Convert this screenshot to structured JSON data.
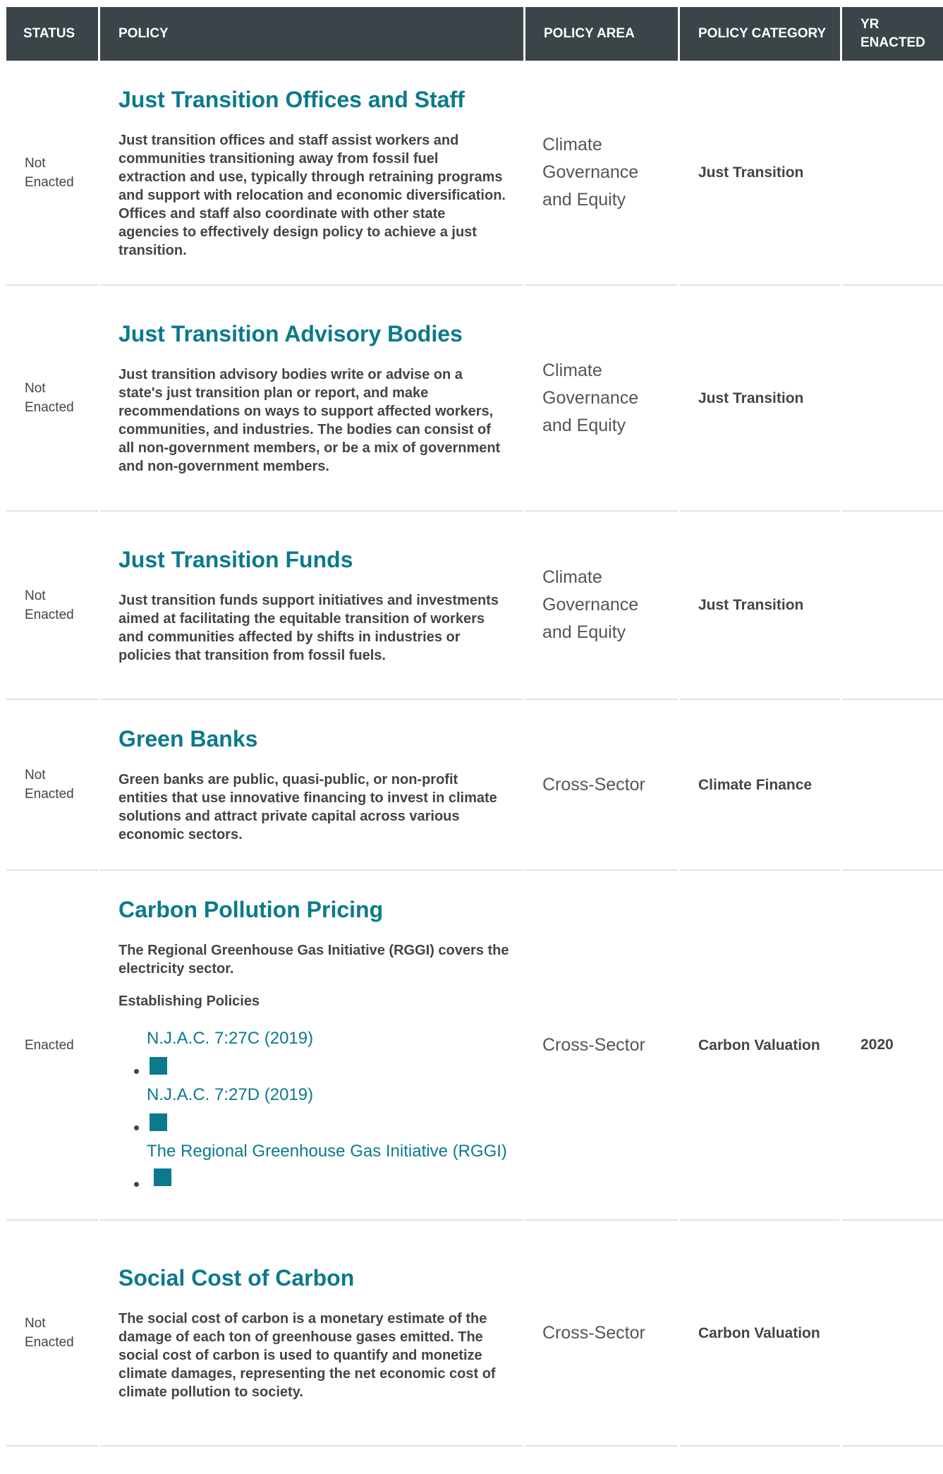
{
  "header": {
    "status": "STATUS",
    "policy": "POLICY",
    "policy_area": "POLICY AREA",
    "policy_category": "POLICY CATEGORY",
    "yr_enacted": "YR ENACTED"
  },
  "rows": [
    {
      "status": "Not Enacted",
      "title": "Just Transition Offices and Staff",
      "description": "Just transition offices and staff assist workers and communities transitioning away from fossil fuel extraction and use, typically through retraining programs and support with relocation and economic diversification. Offices and staff also coordinate with other state agencies to effectively design policy to achieve a just transition.",
      "area": "Climate Governance and Equity",
      "category": "Just Transition",
      "year": ""
    },
    {
      "status": "Not Enacted",
      "title": "Just Transition Advisory Bodies",
      "description": "Just transition advisory bodies write or advise on a state's just transition plan or report, and make recommendations on ways to support affected workers, communities, and industries. The bodies can consist of all non-government members, or be a mix of government and non-government members.",
      "area": "Climate Governance and Equity",
      "category": "Just Transition",
      "year": ""
    },
    {
      "status": "Not Enacted",
      "title": "Just Transition Funds",
      "description": "Just transition funds support initiatives and investments aimed at facilitating the equitable transition of workers and communities affected by shifts in industries or policies that transition from fossil fuels.",
      "area": "Climate Governance and Equity",
      "category": "Just Transition",
      "year": ""
    },
    {
      "status": "Not Enacted",
      "title": "Green Banks",
      "description": "Green banks are public, quasi-public, or non-profit entities that use innovative financing to invest in climate solutions and attract private capital across various economic sectors.",
      "area": "Cross-Sector",
      "category": "Climate Finance",
      "year": ""
    },
    {
      "status": "Enacted",
      "title": "Carbon Pollution Pricing",
      "description": "The Regional Greenhouse Gas Initiative (RGGI) covers the electricity sector.",
      "establishing_label": "Establishing Policies",
      "links": [
        "N.J.A.C. 7:27C (2019)",
        "N.J.A.C. 7:27D (2019)",
        "The Regional Greenhouse Gas Initiative (RGGI)"
      ],
      "area": "Cross-Sector",
      "category": "Carbon Valuation",
      "year": "2020"
    },
    {
      "status": "Not Enacted",
      "title": "Social Cost of Carbon",
      "description": "The social cost of carbon is a monetary estimate of the damage of each ton of greenhouse gases emitted. The social cost of carbon is used to quantify and monetize climate damages, representing the net economic cost of climate pollution to society.",
      "area": "Cross-Sector",
      "category": "Carbon Valuation",
      "year": ""
    }
  ],
  "colors": {
    "header_bg": "#3b4448",
    "link": "#0b7a8c",
    "text": "#444444"
  },
  "icons": [
    "external-link-icon",
    "list-bullet"
  ]
}
